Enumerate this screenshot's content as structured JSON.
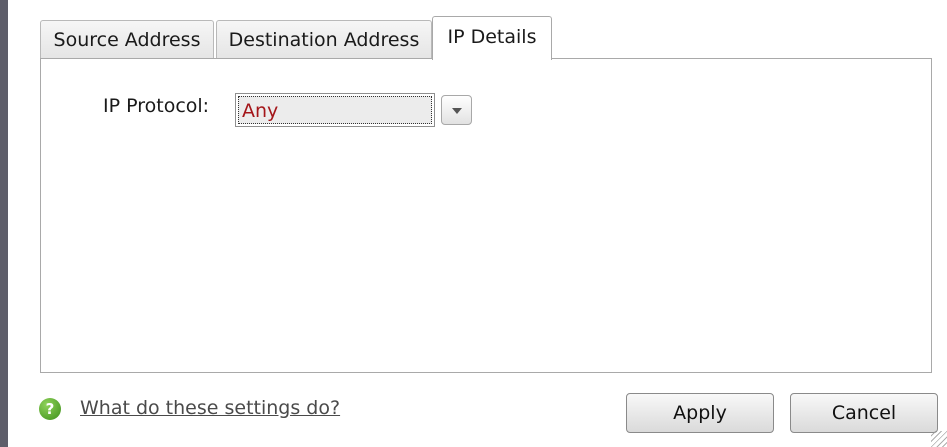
{
  "tabs": [
    {
      "label": "Source Address"
    },
    {
      "label": "Destination Address"
    },
    {
      "label": "IP Details",
      "active": true
    }
  ],
  "ip_details": {
    "protocol_label": "IP Protocol:",
    "protocol_value": "Any",
    "protocol_value_color": "#a4161a"
  },
  "footer": {
    "help_icon": "question-icon",
    "help_icon_glyph": "?",
    "help_link": "What do these settings do?",
    "apply_label": "Apply",
    "cancel_label": "Cancel"
  }
}
